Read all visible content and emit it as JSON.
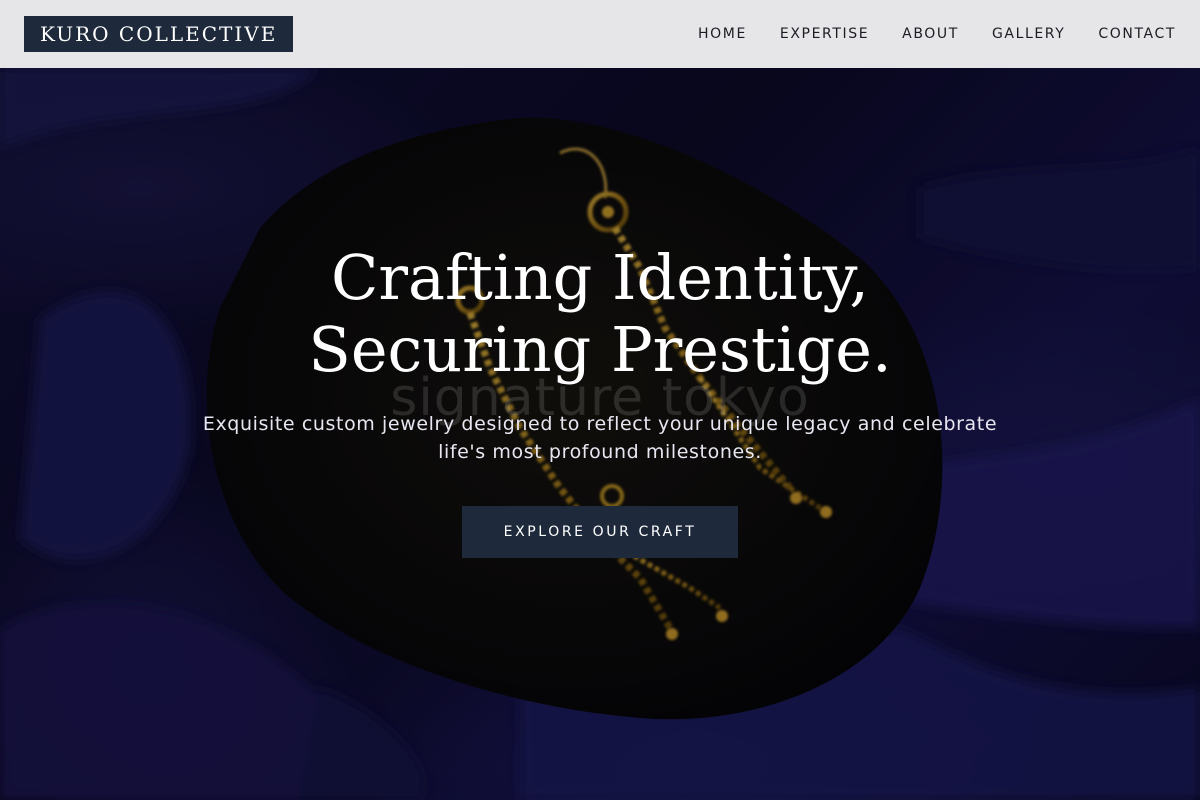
{
  "header": {
    "logo": "KURO COLLECTIVE",
    "nav": [
      {
        "label": "HOME"
      },
      {
        "label": "EXPERTISE"
      },
      {
        "label": "ABOUT"
      },
      {
        "label": "GALLERY"
      },
      {
        "label": "CONTACT"
      }
    ]
  },
  "hero": {
    "headline_line1": "Crafting Identity,",
    "headline_line2": "Securing Prestige.",
    "subtext_line1": "Exquisite custom jewelry designed to reflect your unique legacy and celebrate",
    "subtext_line2": "life's most profound milestones.",
    "cta_label": "EXPLORE OUR CRAFT",
    "watermark_text": "signature tokyo",
    "image_subject": "gold-earrings-on-velvet"
  },
  "colors": {
    "header_bg": "#e6e6e8",
    "brand_dark": "#1e2a3c",
    "velvet": "#1b185a",
    "gold": "#b98a1e"
  }
}
